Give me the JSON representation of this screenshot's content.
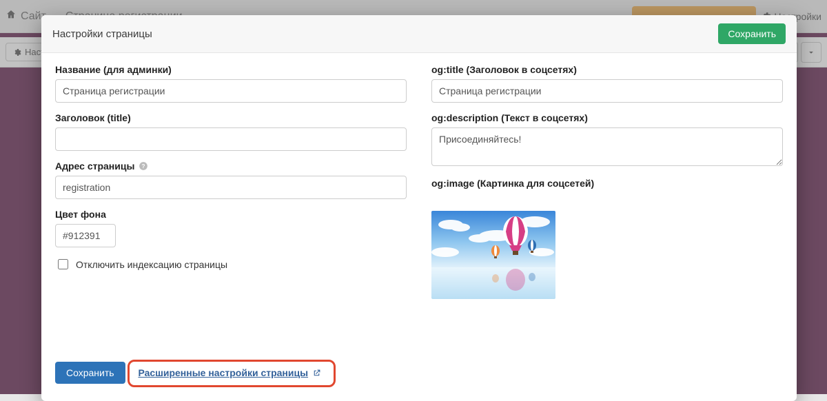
{
  "bg": {
    "breadcrumb_site": "Сайт",
    "breadcrumb_page": "Страница регистрации",
    "settings_link": "Настройки",
    "toolbar_settings": "Настройки"
  },
  "modal": {
    "title": "Настройки страницы",
    "save": "Сохранить",
    "footer_save": "Сохранить",
    "advanced_link": "Расширенные настройки страницы"
  },
  "left": {
    "name_label": "Название (для админки)",
    "name_value": "Страница регистрации",
    "title_label": "Заголовок (title)",
    "title_value": "",
    "slug_label": "Адрес страницы",
    "slug_value": "registration",
    "bgcolor_label": "Цвет фона",
    "bgcolor_value": "#912391",
    "noindex_label": "Отключить индексацию страницы"
  },
  "right": {
    "ogtitle_label": "og:title (Заголовок в соцсетях)",
    "ogtitle_value": "Страница регистрации",
    "ogdesc_label": "og:description (Текст в соцсетях)",
    "ogdesc_value": "Присоединяйтесь!",
    "ogimage_label": "og:image (Картинка для соцсетей)"
  }
}
